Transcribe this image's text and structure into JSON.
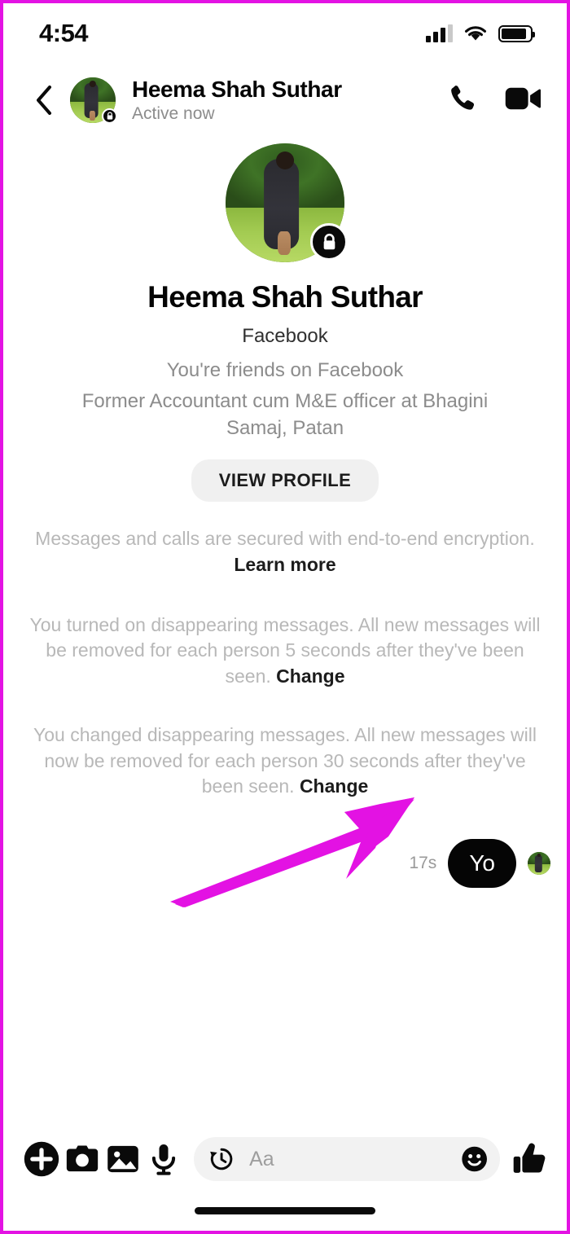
{
  "status_bar": {
    "time": "4:54",
    "signal_icon": "cellular-signal-icon",
    "wifi_icon": "wifi-icon",
    "battery_icon": "battery-icon"
  },
  "header": {
    "back_icon": "chevron-left-icon",
    "avatar_name": "avatar",
    "encrypted_badge_icon": "lock-icon",
    "name": "Heema Shah Suthar",
    "status": "Active now",
    "call_icon": "phone-icon",
    "video_icon": "video-camera-icon"
  },
  "profile": {
    "avatar_name": "profile-avatar",
    "encrypted_badge_icon": "lock-icon",
    "name": "Heema Shah Suthar",
    "source": "Facebook",
    "relationship": "You're friends on Facebook",
    "bio": "Former Accountant cum M&E officer at Bhagini Samaj, Patan",
    "view_profile_label": "VIEW PROFILE"
  },
  "system_notes": {
    "encryption": {
      "text": "Messages and calls are secured with end-to-end encryption.",
      "link": "Learn more"
    },
    "disappearing_on": {
      "text": "You turned on disappearing messages. All new messages will be removed for each person 5 seconds after they've been seen.",
      "link": "Change"
    },
    "disappearing_changed": {
      "text": "You changed disappearing messages. All new messages will now be removed for each person 30 seconds after they've been seen.",
      "link": "Change"
    }
  },
  "messages": [
    {
      "text": "Yo",
      "time": "17s",
      "outgoing": true,
      "seen_avatar": "seen-avatar"
    }
  ],
  "annotation": {
    "type": "arrow",
    "color": "#e312e3",
    "points_to": "17s"
  },
  "toolbar": {
    "add_icon": "plus-circle-icon",
    "camera_icon": "camera-icon",
    "gallery_icon": "image-icon",
    "mic_icon": "microphone-icon",
    "timer_icon": "clock-history-icon",
    "input_placeholder": "Aa",
    "input_value": "",
    "emoji_icon": "smiley-icon",
    "like_icon": "thumbs-up-icon"
  },
  "colors": {
    "annotation": "#e312e3",
    "bubble_outgoing_bg": "#050505",
    "bubble_outgoing_text": "#ffffff",
    "muted_text": "#b8b8b8",
    "composer_bg": "#f2f2f2"
  }
}
